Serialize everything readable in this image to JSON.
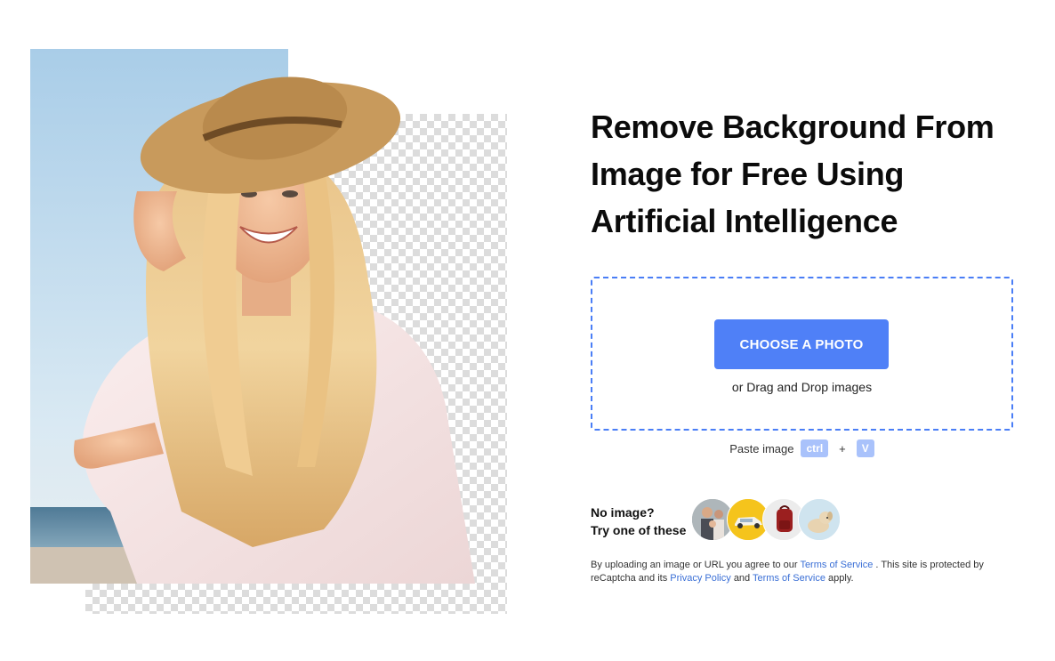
{
  "headline": {
    "line1": "Remove Background From",
    "line2": "Image for Free Using",
    "line3": "Artificial Intelligence"
  },
  "upload": {
    "button_label": "CHOOSE A PHOTO",
    "drag_text": "or Drag and Drop images"
  },
  "paste": {
    "label": "Paste image",
    "key1": "ctrl",
    "plus": "+",
    "key2": "V"
  },
  "samples": {
    "line1": "No image?",
    "line2": "Try one of these",
    "items": [
      "family-photo-sample",
      "yellow-car-sample",
      "red-backpack-sample",
      "puppy-sample"
    ]
  },
  "legal": {
    "text1": "By uploading an image or URL you agree to our",
    "link1": "Terms of Service",
    "text2": ". This site is protected by reCaptcha and its",
    "link2": "Privacy Policy",
    "text3": "and",
    "link3": "Terms of Service",
    "text4": "apply."
  },
  "colors": {
    "accent": "#4f80f7",
    "dashed_border": "#4a7ef6",
    "link": "#3a6fd6",
    "key_bg": "#a9c2fb"
  }
}
